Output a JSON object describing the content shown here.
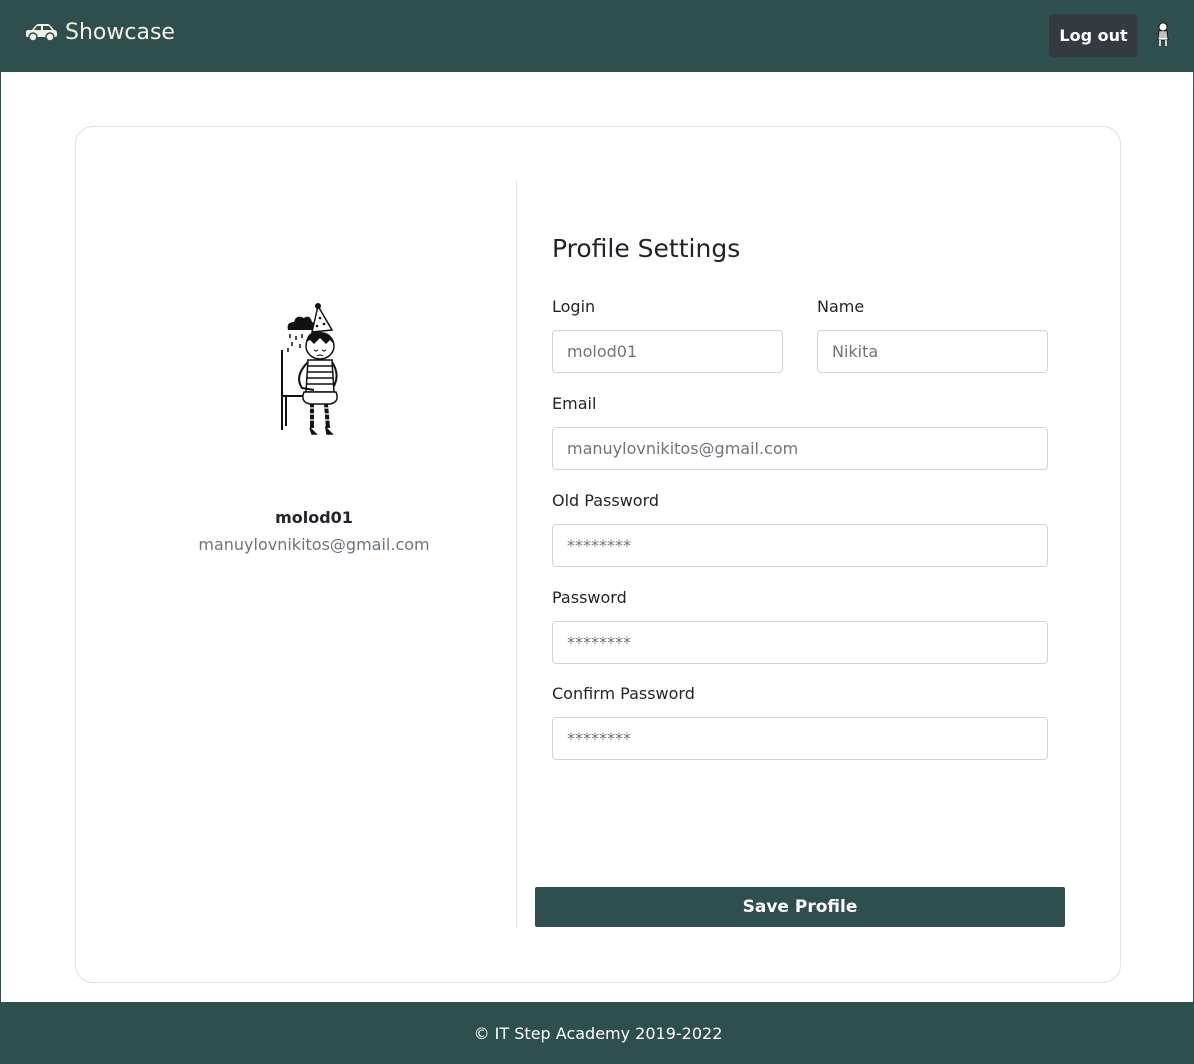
{
  "navbar": {
    "brand_icon": "car-icon",
    "brand_label": "Showcase",
    "logout_label": "Log out",
    "avatar_icon": "user-avatar"
  },
  "profile": {
    "login": "molod01",
    "email": "manuylovnikitos@gmail.com",
    "image": "girl-illustration"
  },
  "form": {
    "title": "Profile Settings",
    "login_label": "Login",
    "login_placeholder": "molod01",
    "name_label": "Name",
    "name_placeholder": "Nikita",
    "email_label": "Email",
    "email_placeholder": "manuylovnikitos@gmail.com",
    "old_password_label": "Old Password",
    "old_password_placeholder": "********",
    "password_label": "Password",
    "password_placeholder": "********",
    "confirm_password_label": "Confirm Password",
    "confirm_password_placeholder": "********",
    "save_label": "Save Profile"
  },
  "footer": {
    "text": "© IT Step Academy 2019-2022"
  },
  "colors": {
    "brand": "#2f4f4f",
    "logout_bg": "#343a40",
    "muted_text": "#6c757d"
  }
}
